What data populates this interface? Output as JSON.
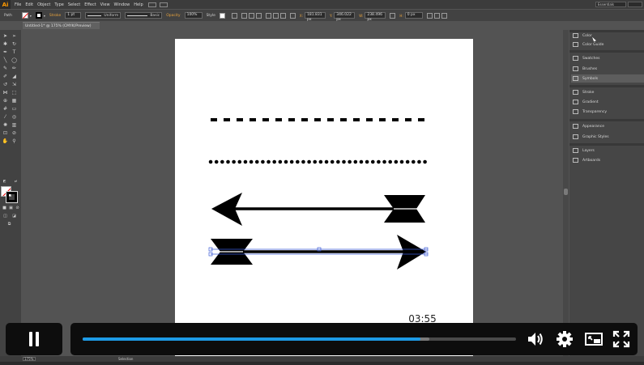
{
  "app": {
    "logo": "Ai",
    "menu": [
      "File",
      "Edit",
      "Object",
      "Type",
      "Select",
      "Effect",
      "View",
      "Window",
      "Help"
    ],
    "workspace": "Essentials"
  },
  "control_bar": {
    "object_type": "Path",
    "stroke_label": "Stroke",
    "stroke_weight": "1 pt",
    "profile": "Uniform",
    "brush": "Basic",
    "opacity_label": "Opacity",
    "opacity_value": "100%",
    "style_label": "Style",
    "x_value": "181.831 px",
    "y_value": "346.022 px",
    "w_value": "238.496 px",
    "h_value": "0 px"
  },
  "document": {
    "tab_title": "Untitled-1* @ 175% (CMYK/Preview)"
  },
  "panels": [
    {
      "label": "Color",
      "icon": "color-icon"
    },
    {
      "label": "Color Guide",
      "icon": "color-guide-icon"
    },
    {
      "label": "Swatches",
      "icon": "swatches-icon"
    },
    {
      "label": "Brushes",
      "icon": "brushes-icon"
    },
    {
      "label": "Symbols",
      "icon": "symbols-icon"
    },
    {
      "label": "Stroke",
      "icon": "stroke-icon"
    },
    {
      "label": "Gradient",
      "icon": "gradient-icon"
    },
    {
      "label": "Transparency",
      "icon": "transparency-icon"
    },
    {
      "label": "Appearance",
      "icon": "appearance-icon"
    },
    {
      "label": "Graphic Styles",
      "icon": "graphic-styles-icon"
    },
    {
      "label": "Layers",
      "icon": "layers-icon"
    },
    {
      "label": "Artboards",
      "icon": "artboards-icon"
    }
  ],
  "status": {
    "zoom": "175%",
    "tool": "Selection"
  },
  "video": {
    "time_tooltip": "03:55",
    "progress": 0.78,
    "buffered": 0.8,
    "accent_color": "#1d9be6"
  }
}
